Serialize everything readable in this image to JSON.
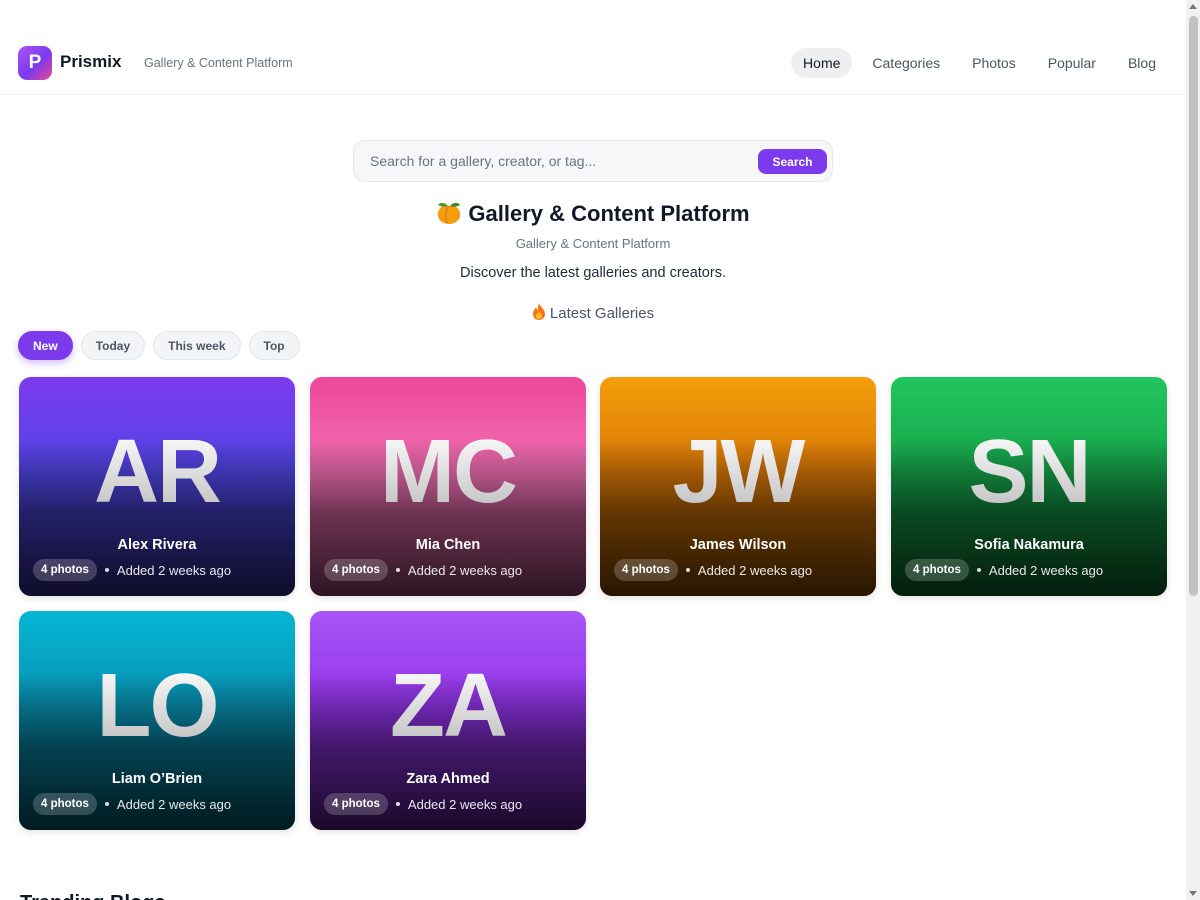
{
  "header": {
    "logo_letter": "P",
    "brand": "Prismix",
    "tagline": "Gallery & Content Platform",
    "nav": [
      "Home",
      "Categories",
      "Photos",
      "Popular",
      "Blog"
    ],
    "active_nav": "Home"
  },
  "search": {
    "placeholder": "Search for a gallery, creator, or tag...",
    "value": "",
    "button_label": "Search"
  },
  "hero": {
    "title": "Gallery & Content Platform",
    "title_icon": "peach-icon",
    "subtitle": "Gallery & Content Platform",
    "description": "Discover the latest galleries and creators."
  },
  "latest_section": {
    "label": "Latest Galleries",
    "icon": "fire-icon"
  },
  "filters": {
    "items": [
      "New",
      "Today",
      "This week",
      "Top"
    ],
    "active": "New"
  },
  "galleries": [
    {
      "initials": "AR",
      "name": "Alex Rivera",
      "photos": "4 photos",
      "added": "Added 2 weeks ago",
      "color_top": "#7c3aed",
      "color_mid": "#4f46e5"
    },
    {
      "initials": "MC",
      "name": "Mia Chen",
      "photos": "4 photos",
      "added": "Added 2 weeks ago",
      "color_top": "#ec4899",
      "color_mid": "#f472b6"
    },
    {
      "initials": "JW",
      "name": "James Wilson",
      "photos": "4 photos",
      "added": "Added 2 weeks ago",
      "color_top": "#f59e0b",
      "color_mid": "#d97706"
    },
    {
      "initials": "SN",
      "name": "Sofia Nakamura",
      "photos": "4 photos",
      "added": "Added 2 weeks ago",
      "color_top": "#22c55e",
      "color_mid": "#16a34a"
    },
    {
      "initials": "LO",
      "name": "Liam O’Brien",
      "photos": "4 photos",
      "added": "Added 2 weeks ago",
      "color_top": "#06b6d4",
      "color_mid": "#0891b2"
    },
    {
      "initials": "ZA",
      "name": "Zara Ahmed",
      "photos": "4 photos",
      "added": "Added 2 weeks ago",
      "color_top": "#a855f7",
      "color_mid": "#9333ea"
    }
  ],
  "next_section": {
    "label": "Trending Blogs"
  },
  "colors": {
    "accent": "#7c3aed",
    "text": "#111827",
    "muted": "#6b7280"
  }
}
